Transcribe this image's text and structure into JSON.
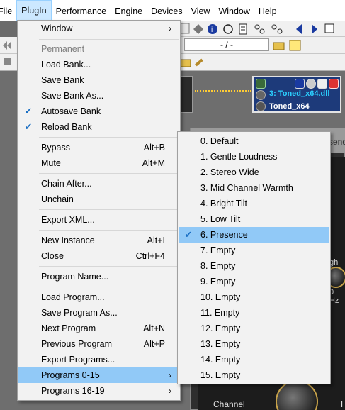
{
  "menubar": {
    "items": [
      {
        "label": "File"
      },
      {
        "label": "PlugIn"
      },
      {
        "label": "Performance"
      },
      {
        "label": "Engine"
      },
      {
        "label": "Devices"
      },
      {
        "label": "View"
      },
      {
        "label": "Window"
      },
      {
        "label": "Help"
      }
    ]
  },
  "toolbar": {
    "slash_field": "- / -"
  },
  "plugin_node": {
    "title": "3: Toned_x64.dll",
    "subtitle": "Toned_x64"
  },
  "plugin_window": {
    "header_fragment": "send",
    "channel_label": "Channel",
    "high_fragment": "gh",
    "hz_fragment": "0 Hz",
    "h_fragment": "H"
  },
  "plugin_menu": {
    "items": [
      {
        "label": "Window",
        "submenu": true
      },
      {
        "label": "Permanent",
        "disabled": true
      },
      {
        "label": "Load Bank..."
      },
      {
        "label": "Save Bank"
      },
      {
        "label": "Save Bank As..."
      },
      {
        "label": "Autosave Bank",
        "checked": true
      },
      {
        "label": "Reload Bank",
        "checked": true
      },
      {
        "label": "Bypass",
        "shortcut": "Alt+B"
      },
      {
        "label": "Mute",
        "shortcut": "Alt+M"
      },
      {
        "label": "Chain After..."
      },
      {
        "label": "Unchain"
      },
      {
        "label": "Export XML..."
      },
      {
        "label": "New Instance",
        "shortcut": "Alt+I"
      },
      {
        "label": "Close",
        "shortcut": "Ctrl+F4"
      },
      {
        "label": "Program Name..."
      },
      {
        "label": "Load Program..."
      },
      {
        "label": "Save Program As..."
      },
      {
        "label": "Next Program",
        "shortcut": "Alt+N"
      },
      {
        "label": "Previous Program",
        "shortcut": "Alt+P"
      },
      {
        "label": "Export Programs..."
      },
      {
        "label": "Programs 0-15",
        "submenu": true,
        "highlighted": true
      },
      {
        "label": "Programs 16-19",
        "submenu": true
      }
    ]
  },
  "programs_submenu": {
    "items": [
      {
        "label": "0. Default"
      },
      {
        "label": "1. Gentle Loudness"
      },
      {
        "label": "2. Stereo Wide"
      },
      {
        "label": "3. Mid Channel Warmth"
      },
      {
        "label": "4. Bright Tilt"
      },
      {
        "label": "5. Low Tilt"
      },
      {
        "label": "6. Presence",
        "checked": true,
        "highlighted": true
      },
      {
        "label": "7. Empty"
      },
      {
        "label": "8. Empty"
      },
      {
        "label": "9. Empty"
      },
      {
        "label": "10. Empty"
      },
      {
        "label": "11. Empty"
      },
      {
        "label": "12. Empty"
      },
      {
        "label": "13. Empty"
      },
      {
        "label": "14. Empty"
      },
      {
        "label": "15. Empty"
      }
    ]
  },
  "glyphs": {
    "submenu_arrow": "›",
    "check": "✔"
  },
  "colors": {
    "highlight": "#91c9f7",
    "menubar_active": "#cce8ff",
    "check_blue": "#1a6fc4",
    "plugin_title": "#2bd0ff",
    "plugin_bg": "#1d3a7a"
  }
}
